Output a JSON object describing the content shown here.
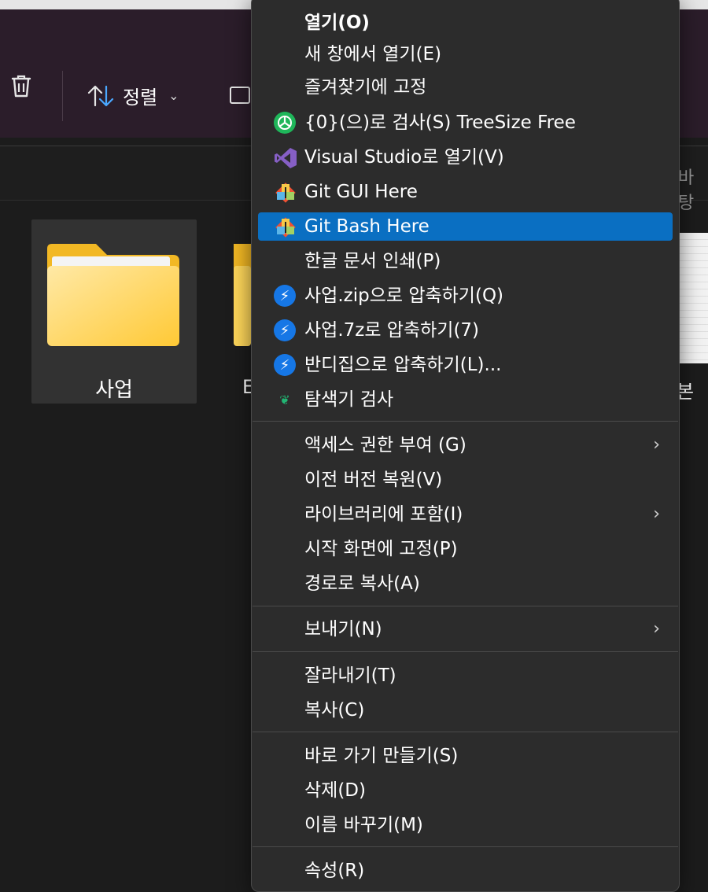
{
  "toolbar": {
    "sort_label": "정렬",
    "right_partial_label": "바탕"
  },
  "files": [
    {
      "name": "사업",
      "selected": true
    },
    {
      "name": "E"
    },
    {
      "name": "본"
    }
  ],
  "menu": {
    "items": [
      {
        "label": "열기(O)",
        "bold": true
      },
      {
        "label": "새 창에서 열기(E)"
      },
      {
        "label": "즐겨찾기에 고정"
      },
      {
        "label": "{0}(으)로 검사(S) TreeSize Free",
        "icon": "treesize-icon"
      },
      {
        "label": "Visual Studio로 열기(V)",
        "icon": "visual-studio-icon"
      },
      {
        "label": "Git GUI Here",
        "icon": "git-icon"
      },
      {
        "label": "Git Bash Here",
        "icon": "git-icon",
        "highlighted": true
      },
      {
        "label": "한글 문서 인쇄(P)"
      },
      {
        "label": "사업.zip으로 압축하기(Q)",
        "icon": "bandizip-icon"
      },
      {
        "label": "사업.7z로 압축하기(7)",
        "icon": "bandizip-icon"
      },
      {
        "label": "반디집으로 압축하기(L)...",
        "icon": "bandizip-icon"
      },
      {
        "label": "탐색기 검사",
        "icon": "leaf-icon"
      },
      {
        "label": "액세스 권한 부여 (G)",
        "submenu": true
      },
      {
        "label": "이전 버전 복원(V)"
      },
      {
        "label": "라이브러리에 포함(I)",
        "submenu": true
      },
      {
        "label": "시작 화면에 고정(P)"
      },
      {
        "label": "경로로 복사(A)"
      },
      {
        "label": "보내기(N)",
        "submenu": true
      },
      {
        "label": "잘라내기(T)"
      },
      {
        "label": "복사(C)"
      },
      {
        "label": "바로 가기 만들기(S)"
      },
      {
        "label": "삭제(D)"
      },
      {
        "label": "이름 바꾸기(M)"
      },
      {
        "label": "속성(R)"
      }
    ]
  },
  "colors": {
    "highlight": "#0a6fc2",
    "menu_bg": "#2c2c2c",
    "toolbar_bg": "#2b1d2a"
  }
}
